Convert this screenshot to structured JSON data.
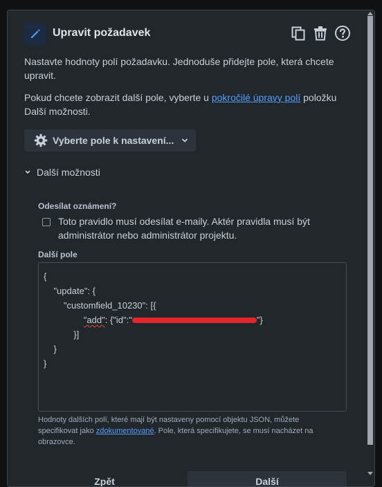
{
  "header": {
    "title": "Upravit požadavek",
    "icon": "pencil-icon",
    "actions": [
      "copy-icon",
      "trash-icon",
      "help-icon"
    ]
  },
  "intro": {
    "line1": "Nastavte hodnoty polí požadavku. Jednoduše přidejte pole, která chcete upravit.",
    "line2_before": "Pokud chcete zobrazit další pole, vyberte u ",
    "line2_link": "pokročilé úpravy polí",
    "line2_after": " položku Další možnosti."
  },
  "field_select": {
    "label": "Vyberte pole k nastavení...",
    "icon": "gear-icon"
  },
  "more_options": {
    "label": "Další možnosti"
  },
  "notification": {
    "label": "Odesílat oznámení?",
    "checkbox_text": "Toto pravidlo musí odesílat e-maily. Aktér pravidla musí být administrátor nebo administrátor projektu.",
    "checked": false
  },
  "additional_fields": {
    "label": "Další pole",
    "code": {
      "l1": "{",
      "l2": "    \"update\": {",
      "l3": "        \"customfield_10230\": [{",
      "l4_key": "\"add\"",
      "l4_mid": ": {\"id\":\"",
      "l4_end": "\"}",
      "l5": "            }]",
      "l6": "    }",
      "l7": "}"
    }
  },
  "helper": {
    "before": "Hodnoty dalších polí, které mají být nastaveny pomocí objektu JSON, můžete specifikovat jako ",
    "link": "zdokumentované",
    "after": ". Pole, která specifikujete, se musí nacházet na obrazovce."
  },
  "footer": {
    "back_label": "Zpět",
    "next_label": "Další"
  },
  "colors": {
    "background": "#22272b",
    "accent": "#579dff",
    "redaction": "#e2262c"
  }
}
